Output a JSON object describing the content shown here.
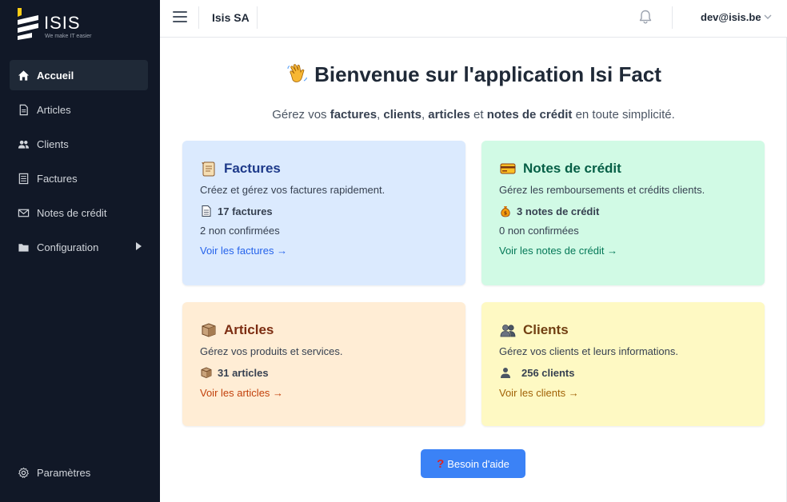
{
  "sidebar": {
    "brand": "ISIS",
    "tagline": "We make IT easier",
    "items": [
      {
        "label": "Accueil",
        "icon": "home-icon",
        "active": true
      },
      {
        "label": "Articles",
        "icon": "document-icon"
      },
      {
        "label": "Clients",
        "icon": "users-icon"
      },
      {
        "label": "Factures",
        "icon": "invoice-icon"
      },
      {
        "label": "Notes de crédit",
        "icon": "envelope-icon"
      },
      {
        "label": "Configuration",
        "icon": "folder-icon"
      }
    ],
    "settings_label": "Paramètres"
  },
  "header": {
    "company": "Isis SA",
    "user": "dev@isis.be"
  },
  "main": {
    "title": "Bienvenue sur l'application Isi Fact",
    "subtitle": {
      "p1": "Gérez vos ",
      "b1": "factures",
      "p2": ", ",
      "b2": "clients",
      "p3": ", ",
      "b3": "articles",
      "p4": " et ",
      "b4": "notes de crédit",
      "p5": " en toute simplicité."
    },
    "cards": {
      "factures": {
        "title": "Factures",
        "desc": "Créez et gérez vos factures rapidement.",
        "count": "17 factures",
        "pending": "2 non confirmées",
        "link": "Voir les factures →"
      },
      "credit": {
        "title": "Notes de crédit",
        "desc": "Gérez les remboursements et crédits clients.",
        "count": "3 notes de crédit",
        "pending": "0 non confirmées",
        "link": "Voir les notes de crédit →"
      },
      "articles": {
        "title": "Articles",
        "desc": "Gérez vos produits et services.",
        "count": "31 articles",
        "link": "Voir les articles →"
      },
      "clients": {
        "title": "Clients",
        "desc": "Gérez vos clients et leurs informations.",
        "count": "256 clients",
        "link": "Voir les clients →"
      }
    },
    "help_label": "Besoin d'aide"
  },
  "colors": {
    "sidebar_bg": "#111827",
    "accent": "#3b82f6"
  }
}
